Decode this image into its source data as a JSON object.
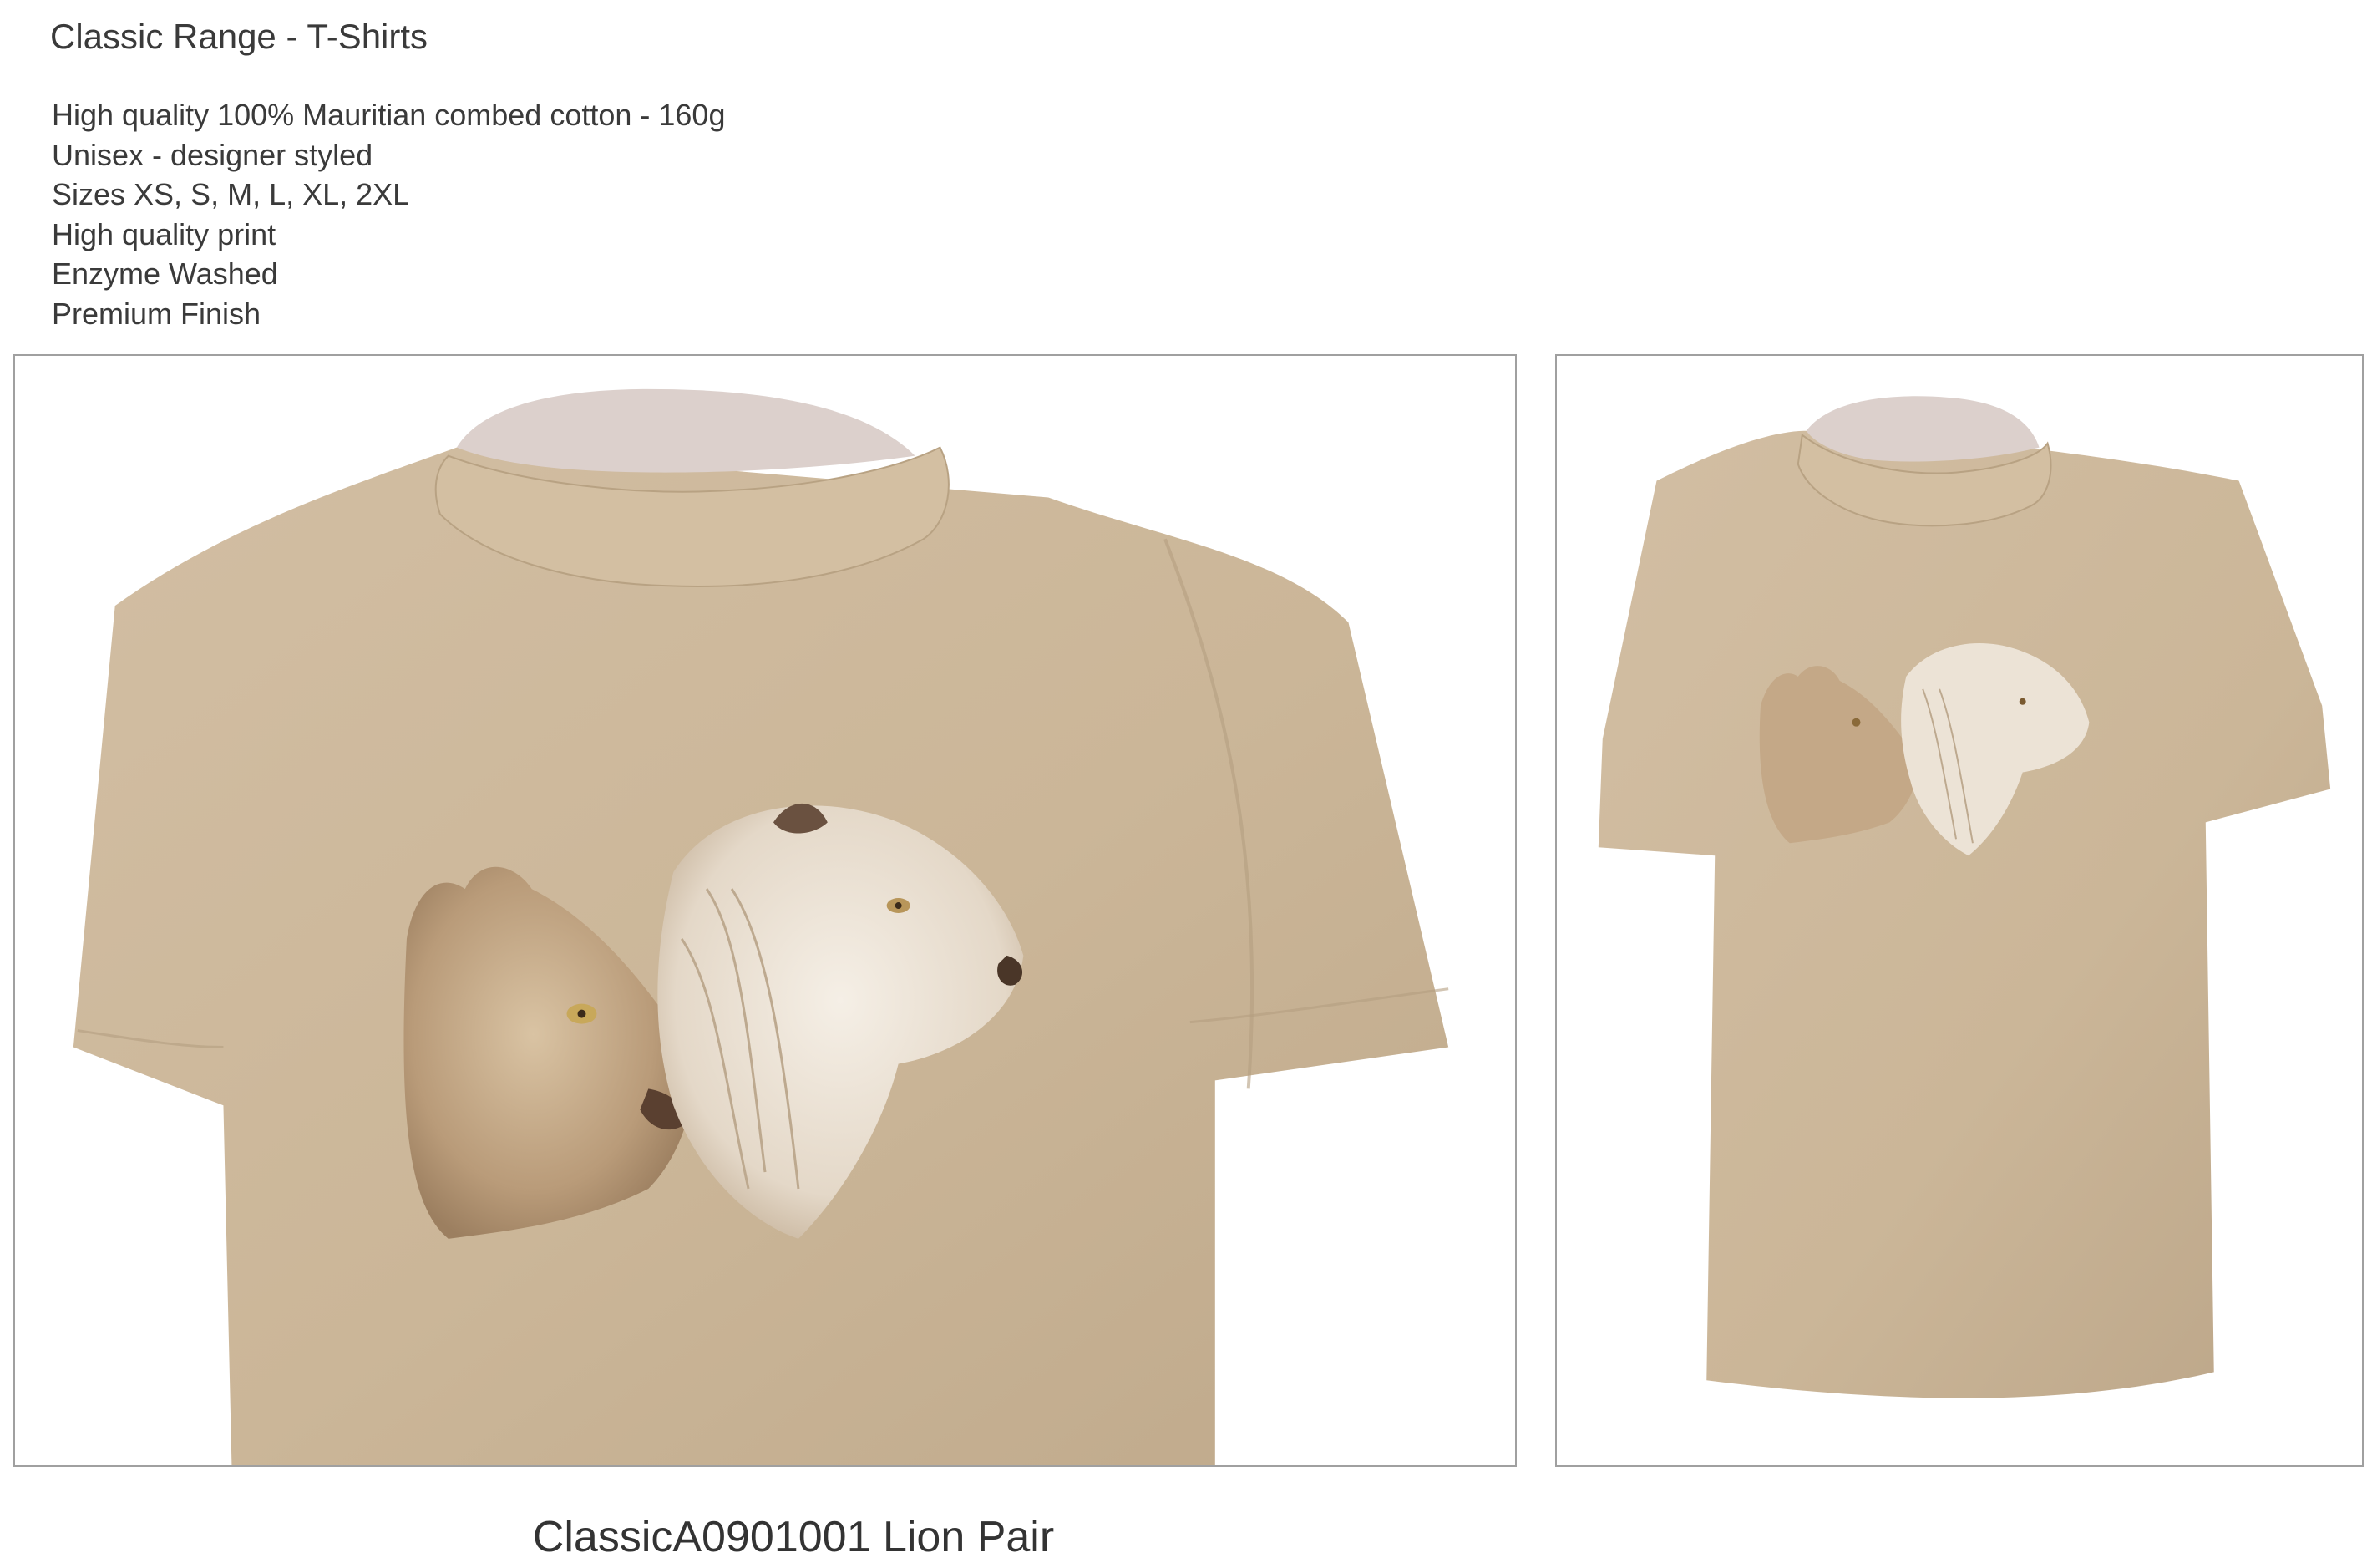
{
  "header": {
    "title": "Classic Range - T-Shirts"
  },
  "features": [
    "High quality 100% Mauritian combed cotton - 160g",
    "Unisex - designer styled",
    "Sizes XS, S, M, L, XL, 2XL",
    "High quality print",
    "Enzyme Washed",
    "Premium Finish"
  ],
  "product": {
    "caption": "ClassicA0901001 Lion Pair",
    "shirt_color": "#cdb89c",
    "collar_inner_color": "#d9ccc8",
    "print_subject": "lioness-and-lion-heads"
  }
}
